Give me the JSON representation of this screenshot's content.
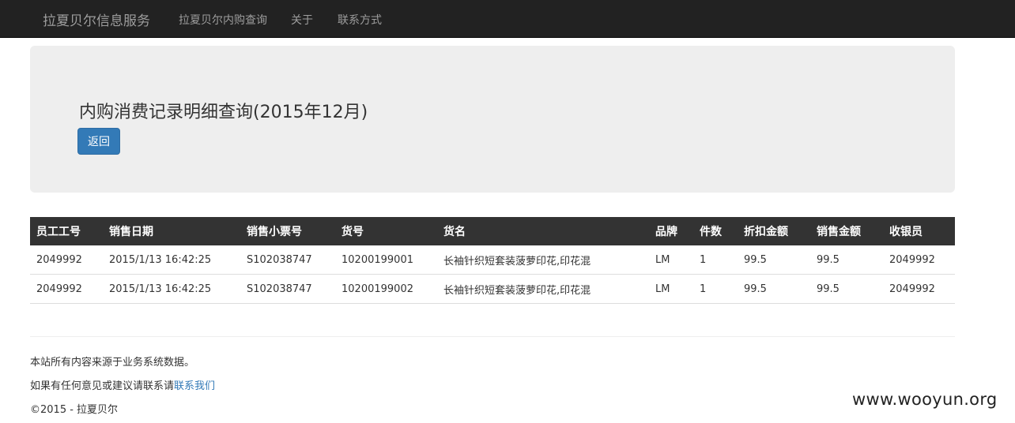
{
  "navbar": {
    "brand": "拉夏贝尔信息服务",
    "links": [
      "拉夏贝尔内购查询",
      "关于",
      "联系方式"
    ]
  },
  "jumbotron": {
    "title": "内购消费记录明细查询(2015年12月)",
    "back_button": "返回"
  },
  "table": {
    "headers": [
      "员工工号",
      "销售日期",
      "销售小票号",
      "货号",
      "货名",
      "品牌",
      "件数",
      "折扣金额",
      "销售金额",
      "收银员"
    ],
    "rows": [
      [
        "2049992",
        "2015/1/13 16:42:25",
        "S102038747",
        "10200199001",
        "长袖针织短套装菠萝印花,印花混",
        "LM",
        "1",
        "99.5",
        "99.5",
        "2049992"
      ],
      [
        "2049992",
        "2015/1/13 16:42:25",
        "S102038747",
        "10200199002",
        "长袖针织短套装菠萝印花,印花混",
        "LM",
        "1",
        "99.5",
        "99.5",
        "2049992"
      ]
    ]
  },
  "footer": {
    "line1": "本站所有内容来源于业务系统数据。",
    "line2_text": "如果有任何意见或建议请联系请",
    "line2_link": "联系我们",
    "copyright": "©2015 - 拉夏贝尔"
  },
  "watermark": "www.wooyun.org",
  "colors": {
    "navbar_bg": "#222222",
    "jumbotron_bg": "#eeeeee",
    "primary_button": "#337ab7",
    "table_header_bg": "#333333",
    "link": "#337ab7"
  }
}
